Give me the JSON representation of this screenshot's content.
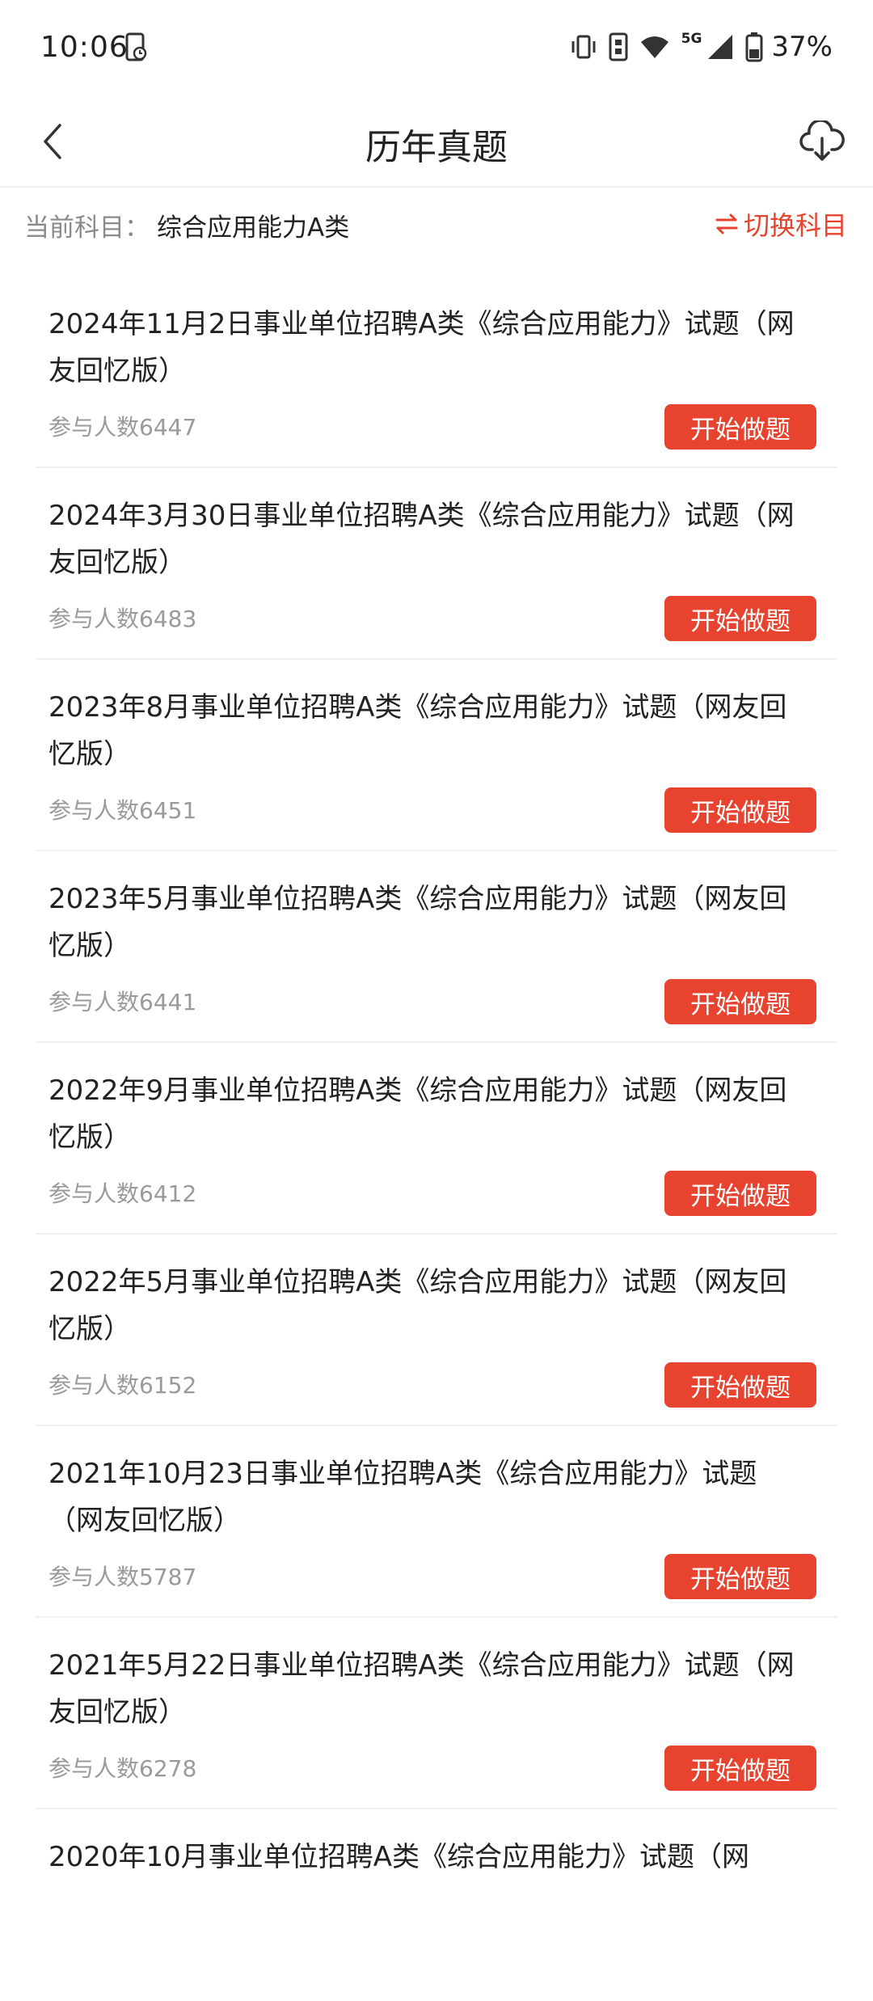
{
  "status_bar": {
    "time": "10:06",
    "network": "5G",
    "battery": "37%"
  },
  "header": {
    "title": "历年真题"
  },
  "subject": {
    "label": "当前科目：",
    "value": "综合应用能力A类",
    "switch_label": "切换科目"
  },
  "accent_color": "#e8432f",
  "icons": [
    "phone-icon",
    "vibrate-icon",
    "sim-icon",
    "wifi-icon",
    "signal-icon",
    "battery-icon",
    "back-arrow-icon",
    "cloud-download-icon",
    "swap-icon"
  ],
  "papers": [
    {
      "title": "2024年11月2日事业单位招聘A类《综合应用能力》试题（网友回忆版）",
      "count": "参与人数6447",
      "button": "开始做题"
    },
    {
      "title": "2024年3月30日事业单位招聘A类《综合应用能力》试题（网友回忆版）",
      "count": "参与人数6483",
      "button": "开始做题"
    },
    {
      "title": "2023年8月事业单位招聘A类《综合应用能力》试题（网友回忆版）",
      "count": "参与人数6451",
      "button": "开始做题"
    },
    {
      "title": "2023年5月事业单位招聘A类《综合应用能力》试题（网友回忆版）",
      "count": "参与人数6441",
      "button": "开始做题"
    },
    {
      "title": "2022年9月事业单位招聘A类《综合应用能力》试题（网友回忆版）",
      "count": "参与人数6412",
      "button": "开始做题"
    },
    {
      "title": "2022年5月事业单位招聘A类《综合应用能力》试题（网友回忆版）",
      "count": "参与人数6152",
      "button": "开始做题"
    },
    {
      "title": "2021年10月23日事业单位招聘A类《综合应用能力》试题（网友回忆版）",
      "count": "参与人数5787",
      "button": "开始做题"
    },
    {
      "title": "2021年5月22日事业单位招聘A类《综合应用能力》试题（网友回忆版）",
      "count": "参与人数6278",
      "button": "开始做题"
    },
    {
      "title": "2020年10月事业单位招聘A类《综合应用能力》试题（网",
      "count": "",
      "button": ""
    }
  ]
}
